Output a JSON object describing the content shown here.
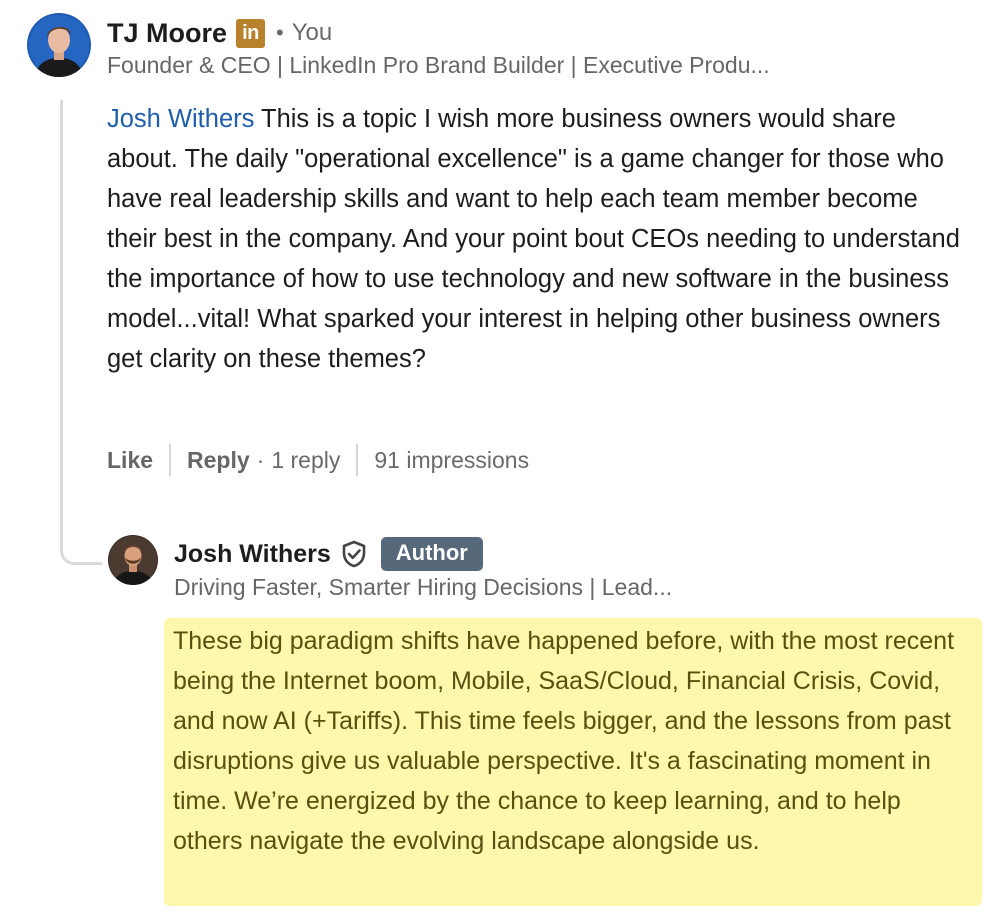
{
  "comment": {
    "author_name": "TJ Moore",
    "linkedin_badge": "in",
    "separator_dot": "•",
    "you_label": "You",
    "headline": "Founder & CEO | LinkedIn Pro Brand Builder | Executive Produ...",
    "mention": "Josh Withers",
    "text": " This is a topic I wish more business owners would share about. The daily \"operational excellence\" is a game changer for those who have real leadership skills and want to help each team member become their best in the company. And your point bout CEOs needing to understand the importance of how to use technology and new software in the business model...vital! What sparked your interest in helping other business owners get clarity on these themes?",
    "actions": {
      "like_label": "Like",
      "reply_label": "Reply",
      "middle_dot": "·",
      "reply_count": "1 reply",
      "impressions": "91 impressions"
    }
  },
  "reply": {
    "author_name": "Josh Withers",
    "author_badge": "Author",
    "headline": "Driving Faster, Smarter Hiring Decisions | Lead...",
    "text": "These big paradigm shifts have happened before, with the most recent being the Internet boom, Mobile, SaaS/Cloud, Financial Crisis, Covid, and now AI (+Tariffs). This time feels bigger, and the lessons from past disruptions give us valuable perspective. It's a fascinating moment in time. We’re energized by the chance to keep learning, and to help others navigate the evolving landscape alongside us."
  },
  "colors": {
    "mention_link": "#1f5dad",
    "linkedin_badge_bg": "#b8812c",
    "author_badge_bg": "#56687a",
    "highlight_bg": "#fdf8ab",
    "highlight_text": "#5a4f0f",
    "secondary_text": "#666666"
  },
  "icons": {
    "verification": "shield-check-icon"
  }
}
